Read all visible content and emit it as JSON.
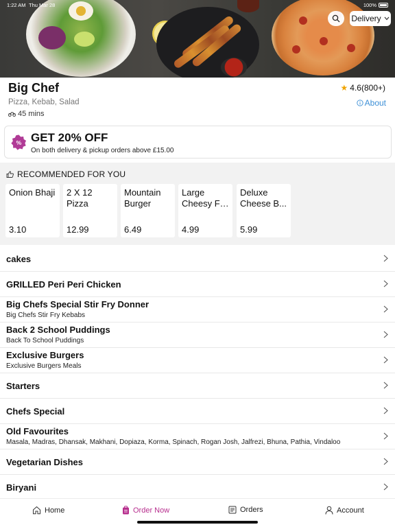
{
  "status_bar": {
    "time": "1:22 AM",
    "date": "Thu Mar 28",
    "battery": "100%"
  },
  "header": {
    "delivery_mode": "Delivery"
  },
  "restaurant": {
    "name": "Big Chef",
    "cuisines": "Pizza, Kebab, Salad",
    "delivery_time": "45 mins",
    "rating": "4.6(800+)",
    "about_label": "About"
  },
  "offer": {
    "title": "GET 20% OFF",
    "subtitle": "On both delivery & pickup orders above £15.00"
  },
  "recommended": {
    "title": "RECOMMENDED FOR YOU",
    "items": [
      {
        "line1": "Onion Bhaji",
        "line2": "",
        "price": "3.10"
      },
      {
        "line1": "2 X 12",
        "line2": "Pizza",
        "price": "12.99"
      },
      {
        "line1": "Mountain",
        "line2": "Burger",
        "price": "6.49"
      },
      {
        "line1": "Large",
        "line2": "Cheesy Fr...",
        "price": "4.99"
      },
      {
        "line1": "Deluxe",
        "line2": "Cheese B...",
        "price": "5.99"
      }
    ]
  },
  "categories": [
    {
      "name": "cakes",
      "desc": ""
    },
    {
      "name": "GRILLED Peri Peri Chicken",
      "desc": ""
    },
    {
      "name": "Big Chefs Special Stir Fry Donner",
      "desc": "Big Chefs Stir Fry Kebabs"
    },
    {
      "name": "Back 2 School Puddings",
      "desc": "Back To School Puddings"
    },
    {
      "name": "Exclusive Burgers",
      "desc": "Exclusive Burgers Meals"
    },
    {
      "name": "Starters",
      "desc": ""
    },
    {
      "name": "Chefs Special",
      "desc": ""
    },
    {
      "name": "Old Favourites",
      "desc": "Masala, Madras, Dhansak, Makhani, Dopiaza, Korma, Spinach, Rogan Josh, Jalfrezi, Bhuna, Pathia, Vindaloo"
    },
    {
      "name": "Vegetarian Dishes",
      "desc": ""
    },
    {
      "name": "Biryani",
      "desc": ""
    }
  ],
  "bottom_nav": {
    "home": "Home",
    "order_now": "Order Now",
    "orders": "Orders",
    "account": "Account"
  },
  "colors": {
    "accent": "#b72f8e",
    "link": "#3c8fd6",
    "star": "#f0a400"
  }
}
